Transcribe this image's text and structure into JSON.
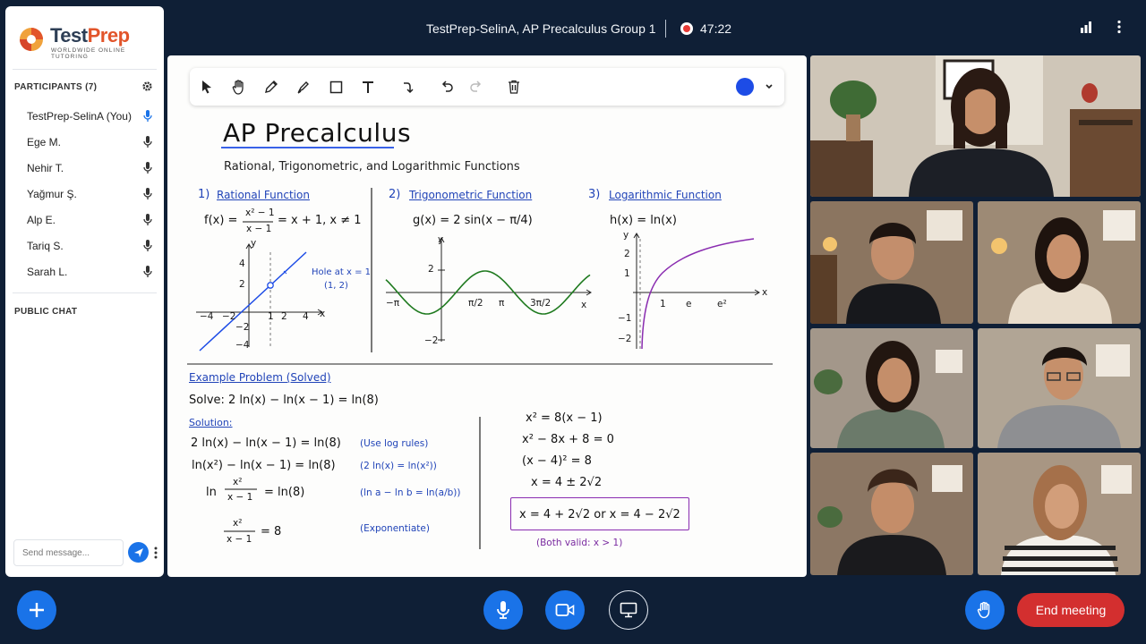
{
  "brand": {
    "name_part1": "Test",
    "name_part2": "Prep",
    "tagline": "WORLDWIDE ONLINE TUTORING"
  },
  "meeting": {
    "title": "TestPrep-SelinA, AP Precalculus Group 1",
    "timer": "47:22"
  },
  "participants": {
    "header": "PARTICIPANTS (7)",
    "items": [
      {
        "name": "TestPrep-SelinA (You)",
        "mic_active": true
      },
      {
        "name": "Ege M.",
        "mic_active": false
      },
      {
        "name": "Nehir T.",
        "mic_active": false
      },
      {
        "name": "Yağmur Ş.",
        "mic_active": false
      },
      {
        "name": "Alp E.",
        "mic_active": false
      },
      {
        "name": "Tariq S.",
        "mic_active": false
      },
      {
        "name": "Sarah L.",
        "mic_active": false
      }
    ]
  },
  "chat": {
    "header": "PUBLIC CHAT",
    "placeholder": "Send message..."
  },
  "whiteboard": {
    "title": "AP Precalculus",
    "subtitle": "Rational, Trigonometric, and Logarithmic Functions",
    "s1": {
      "heading_num": "1)",
      "heading": "Rational Function",
      "formula_lhs": "f(x) =",
      "frac_num": "x² − 1",
      "frac_den": "x − 1",
      "formula_rhs": "= x + 1, x ≠ 1",
      "hole_label": "Hole at x = 1",
      "hole_point": "(1, 2)",
      "y_ticks": [
        "4",
        "2",
        "−2",
        "−4"
      ],
      "x_ticks": [
        "−4",
        "−2",
        "1",
        "2",
        "4"
      ],
      "x_axis": "x",
      "y_axis": "y"
    },
    "s2": {
      "heading_num": "2)",
      "heading": "Trigonometric Function",
      "formula": "g(x) = 2 sin(x − π/4)",
      "y_ticks": [
        "2",
        "−2"
      ],
      "x_ticks": [
        "−π",
        "π/2",
        "π",
        "3π/2"
      ],
      "x_axis": "x",
      "y_axis": "y"
    },
    "s3": {
      "heading_num": "3)",
      "heading": "Logarithmic Function",
      "formula": "h(x) = ln(x)",
      "y_ticks": [
        "2",
        "1",
        "−1",
        "−2"
      ],
      "x_ticks": [
        "1",
        "e",
        "e²"
      ],
      "x_axis": "x",
      "y_axis": "y"
    },
    "example": {
      "heading": "Example Problem (Solved)",
      "problem": "Solve:  2 ln(x) − ln(x − 1) = ln(8)",
      "solution_label": "Solution:",
      "step1": "2 ln(x) − ln(x − 1) = ln(8)",
      "note1": "(Use log rules)",
      "step2": "ln(x²) − ln(x − 1) = ln(8)",
      "note2": "(2 ln(x) = ln(x²))",
      "step3_ln": "ln",
      "step3_num": "x²",
      "step3_den": "x − 1",
      "step3_rhs": "= ln(8)",
      "note3": "(ln a − ln b = ln(a/b))",
      "step4_num": "x²",
      "step4_den": "x − 1",
      "step4_rhs": "= 8",
      "note4": "(Exponentiate)",
      "r1": "x² = 8(x − 1)",
      "r2": "x² − 8x + 8 = 0",
      "r3": "(x − 4)² = 8",
      "r4": "x = 4 ± 2√2",
      "answer": "x = 4 + 2√2  or  x = 4 − 2√2",
      "note_final": "(Both valid: x > 1)"
    }
  },
  "controls": {
    "end_label": "End meeting"
  },
  "colors": {
    "accent": "#1a73e8",
    "end": "#d32f2f",
    "pen": "#1d4ce6",
    "background": "#0f1f36"
  }
}
